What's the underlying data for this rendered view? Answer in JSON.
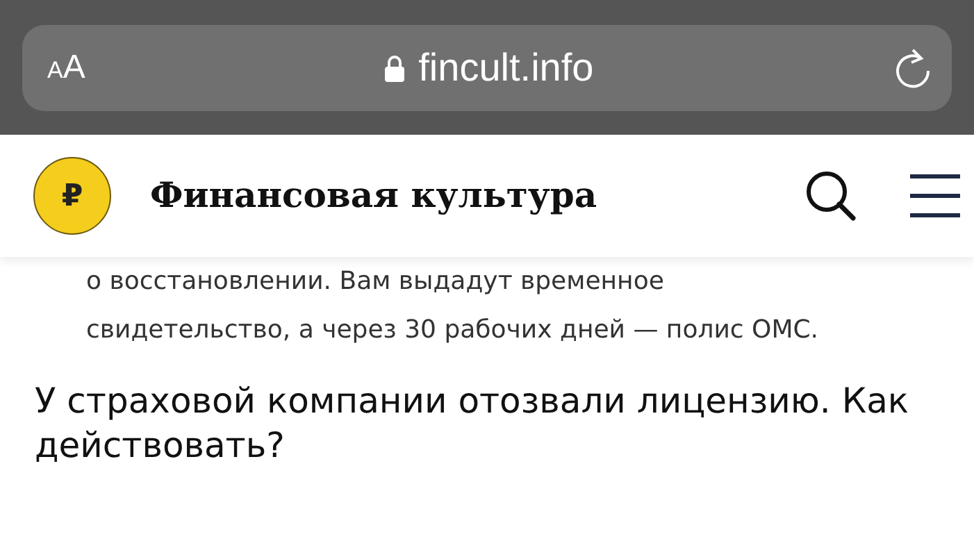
{
  "browser": {
    "text_size_button": "AA",
    "url": "fincult.info"
  },
  "site_header": {
    "logo_symbol": "₽",
    "site_name": "Финансовая культура"
  },
  "article": {
    "paragraph": "о восстановлении. Вам выдадут временное свидетельство, а через 30 рабочих дней — полис ОМС.",
    "heading": "У страховой компании отозвали лицензию. Как действовать?"
  }
}
